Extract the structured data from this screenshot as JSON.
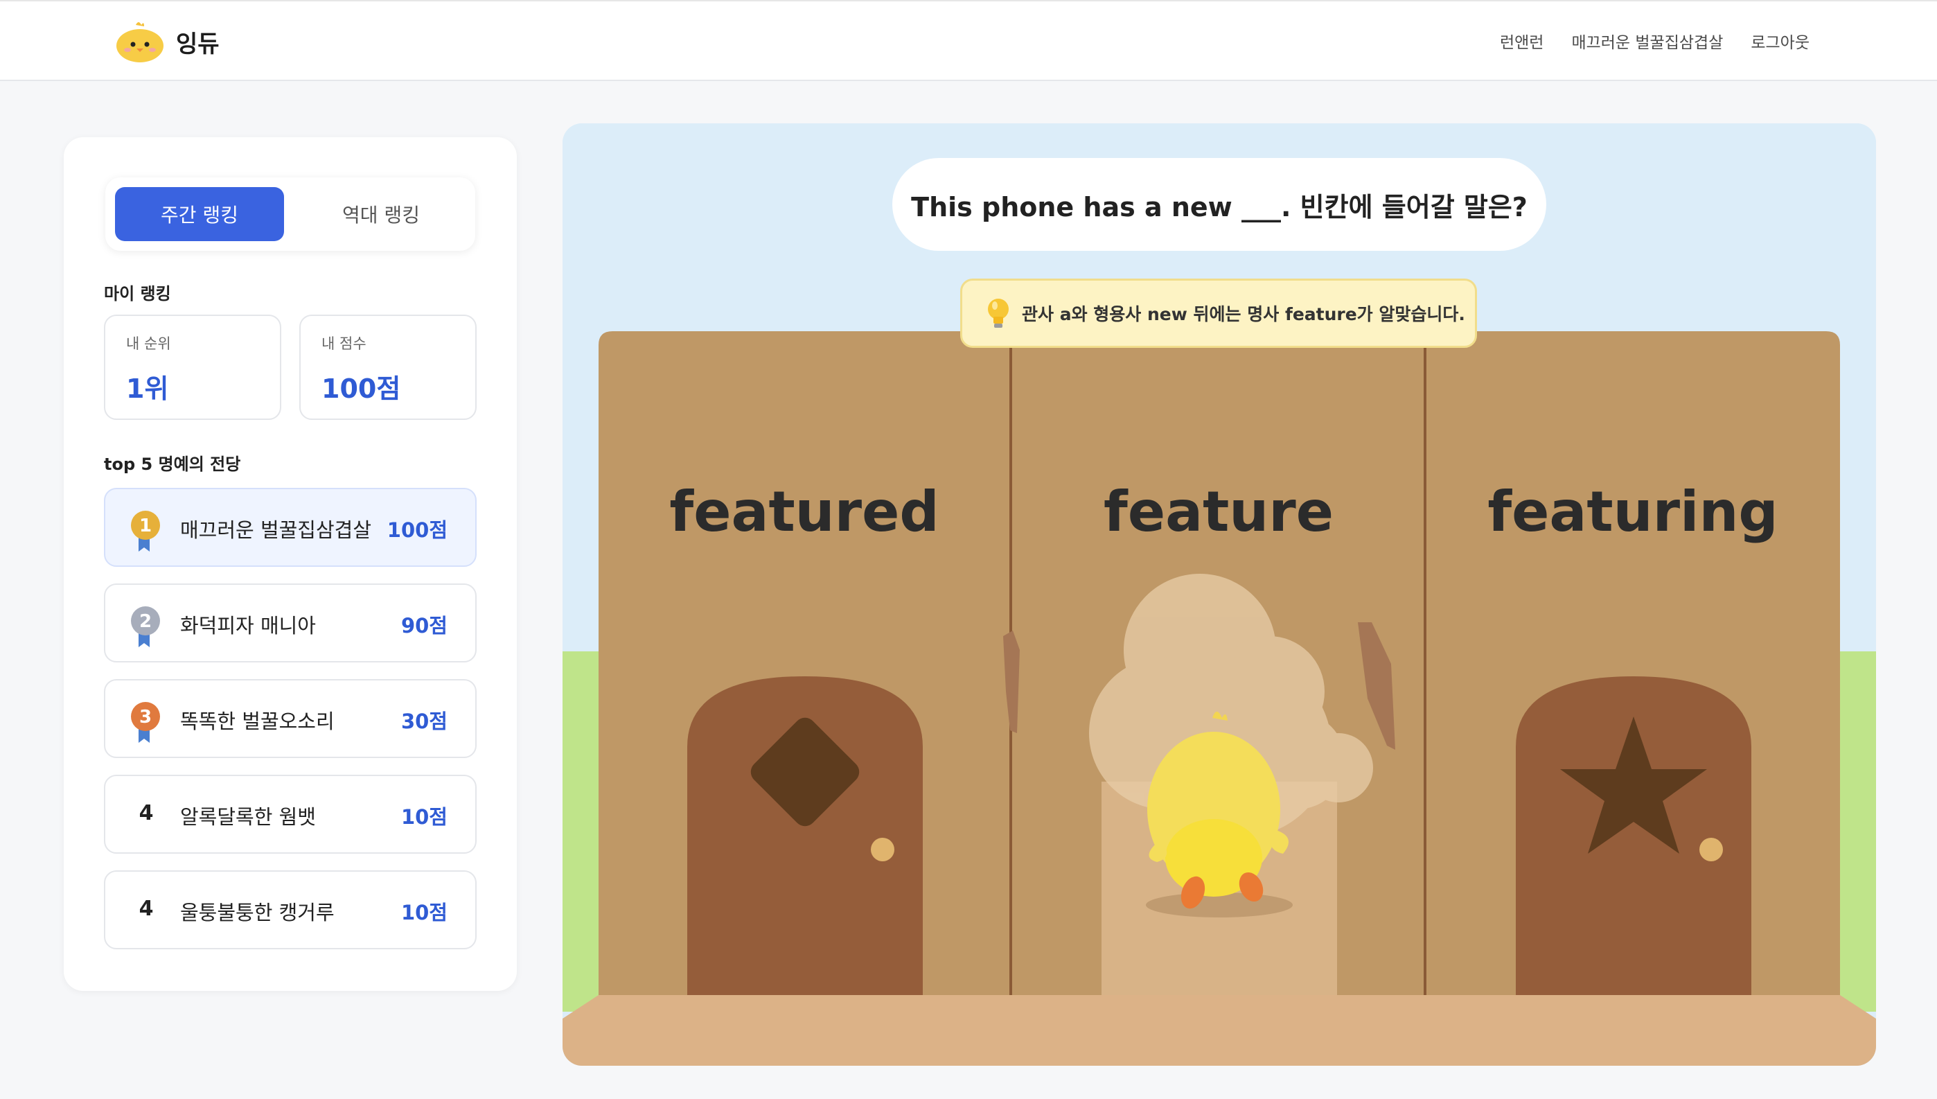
{
  "header": {
    "logo_text": "잉듀",
    "nav": [
      "런앤런",
      "매끄러운 벌꿀집삼겹살",
      "로그아웃"
    ]
  },
  "sidebar": {
    "tabs": {
      "weekly": "주간 랭킹",
      "alltime": "역대 랭킹"
    },
    "my_ranking_title": "마이 랭킹",
    "my_rank_label": "내 순위",
    "my_rank_value": "1위",
    "my_score_label": "내 점수",
    "my_score_value": "100점",
    "hall_title": "top 5 명예의 전당",
    "ranks": [
      {
        "rank": "1",
        "name": "매끄러운 벌꿀집삼겹살",
        "score": "100점",
        "medal": "gold"
      },
      {
        "rank": "2",
        "name": "화덕피자 매니아",
        "score": "90점",
        "medal": "silver"
      },
      {
        "rank": "3",
        "name": "똑똑한 벌꿀오소리",
        "score": "30점",
        "medal": "bronze"
      },
      {
        "rank": "4",
        "name": "알록달록한 웜뱃",
        "score": "10점"
      },
      {
        "rank": "4",
        "name": "울퉁불퉁한 캥거루",
        "score": "10점"
      }
    ]
  },
  "game": {
    "question": "This phone has a new ___. 빈칸에 들어갈 말은?",
    "hint": "관사 a와 형용사 new 뒤에는 명사 feature가 알맞습니다.",
    "choices": [
      "featured",
      "feature",
      "featuring"
    ],
    "colors": {
      "sky": "#dcedf9",
      "grass": "#bfe48a",
      "wall": "#bf9866",
      "door": "#955d3a",
      "floor": "#dcb287"
    }
  }
}
